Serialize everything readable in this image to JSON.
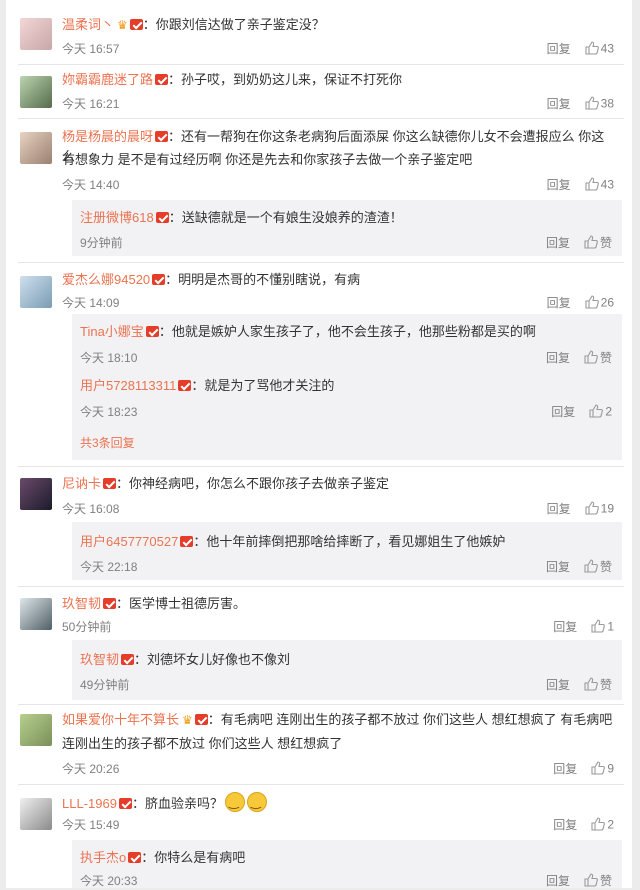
{
  "reply_label": "回复",
  "comments": [
    {
      "name": "温柔词丶",
      "crown": true,
      "text": "你跟刘信达做了亲子鉴定没？",
      "time": "今天 16:57",
      "likes": "43"
    },
    {
      "name": "妳霸霸鹿迷了路",
      "crown": false,
      "text": "孙子哎，到奶奶这儿来，保证不打死你",
      "time": "今天 16:21",
      "likes": "38"
    },
    {
      "name": "杨是杨晨的晨呀",
      "crown": false,
      "text": "还有一帮狗在你这条老病狗后面添屎 你这么缺德你儿女不会遭报应么 你这么",
      "text2": "有想象力 是不是有过经历啊 你还是先去和你家孩子去做一个亲子鉴定吧",
      "time": "今天 14:40",
      "likes": "43",
      "replies": [
        {
          "name": "注册微博618",
          "text": "送缺德就是一个有娘生没娘养的渣渣！",
          "time": "9分钟前",
          "likes": "赞"
        }
      ]
    },
    {
      "name": "爱杰么娜94520",
      "crown": false,
      "text": "明明是杰哥的不懂别瞎说，有病",
      "time": "今天 14:09",
      "likes": "26",
      "replies": [
        {
          "name": "Tina小娜宝",
          "text": "他就是嫉妒人家生孩子了，他不会生孩子，他那些粉都是买的啊",
          "time": "今天 18:10",
          "likes": "赞"
        },
        {
          "name": "用户5728113311",
          "text": "就是为了骂他才关注的",
          "time": "今天 18:23",
          "likes": "2"
        }
      ],
      "more": "共3条回复"
    },
    {
      "name": "尼讷卡",
      "crown": false,
      "text": "你神经病吧，你怎么不跟你孩子去做亲子鉴定",
      "time": "今天 16:08",
      "likes": "19",
      "replies": [
        {
          "name": "用户6457770527",
          "text": "他十年前摔倒把那啥给摔断了，看见娜姐生了他嫉妒",
          "time": "今天 22:18",
          "likes": "赞"
        }
      ]
    },
    {
      "name": "玖智韧",
      "crown": false,
      "text": "医学博士祖德厉害。",
      "time": "50分钟前",
      "likes": "1",
      "replies": [
        {
          "name": "玖智韧",
          "text": "刘德坏女儿好像也不像刘",
          "time": "49分钟前",
          "likes": "赞"
        }
      ]
    },
    {
      "name": "如果爱你十年不算长",
      "crown": true,
      "text": "有毛病吧 连刚出生的孩子都不放过 你们这些人 想红想疯了 有毛病吧",
      "text2": "连刚出生的孩子都不放过 你们这些人 想红想疯了",
      "time": "今天 20:26",
      "likes": "9"
    },
    {
      "name": "LLL-1969",
      "crown": false,
      "text": "脐血验亲吗？",
      "smileys": true,
      "time": "今天 15:49",
      "likes": "2",
      "replies": [
        {
          "name": "执手杰o",
          "text": "你特么是有病吧",
          "time": "今天 20:33",
          "likes": "赞"
        }
      ]
    }
  ]
}
